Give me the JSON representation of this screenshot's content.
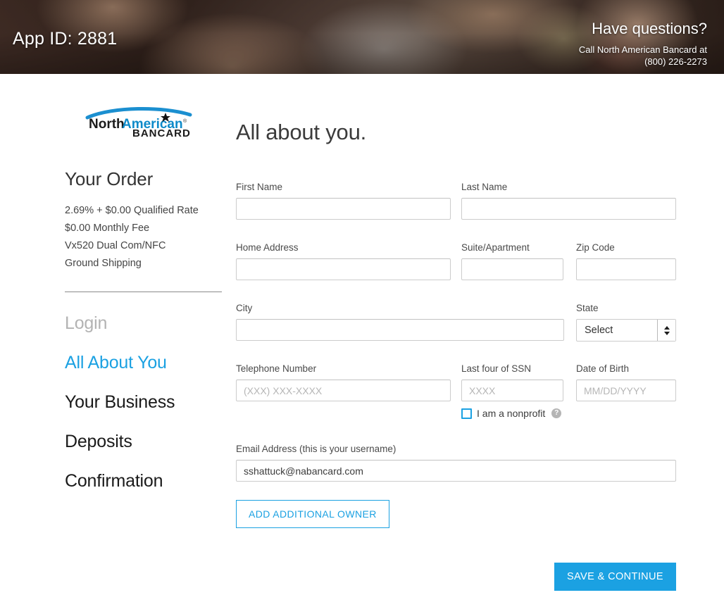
{
  "hero": {
    "app_id_label": "App ID: 2881",
    "questions_heading": "Have questions?",
    "call_line1": "Call North American Bancard at",
    "call_line2": "(800) 226-2273"
  },
  "brand": {
    "logo_north": "North",
    "logo_american": "American",
    "logo_bancard": "BANCARD",
    "logo_registered": "®",
    "accent_color": "#1BA1E2",
    "logo_blue": "#0D8AC9"
  },
  "sidebar": {
    "order_title": "Your Order",
    "order_items": [
      "2.69% + $0.00 Qualified Rate",
      "$0.00 Monthly Fee",
      "Vx520 Dual Com/NFC",
      "Ground Shipping"
    ],
    "nav_items": [
      {
        "label": "Login",
        "state": "done"
      },
      {
        "label": "All About You",
        "state": "active"
      },
      {
        "label": "Your Business",
        "state": "todo"
      },
      {
        "label": "Deposits",
        "state": "todo"
      },
      {
        "label": "Confirmation",
        "state": "todo"
      }
    ]
  },
  "form": {
    "title": "All about you.",
    "first_name": {
      "label": "First Name",
      "value": "",
      "placeholder": ""
    },
    "last_name": {
      "label": "Last Name",
      "value": "",
      "placeholder": ""
    },
    "home_address": {
      "label": "Home Address",
      "value": "",
      "placeholder": ""
    },
    "suite": {
      "label": "Suite/Apartment",
      "value": "",
      "placeholder": ""
    },
    "zip": {
      "label": "Zip Code",
      "value": "",
      "placeholder": ""
    },
    "city": {
      "label": "City",
      "value": "",
      "placeholder": ""
    },
    "state": {
      "label": "State",
      "selected": "Select",
      "options": [
        "Select"
      ]
    },
    "telephone": {
      "label": "Telephone Number",
      "value": "",
      "placeholder": "(XXX) XXX-XXXX"
    },
    "ssn": {
      "label": "Last four of SSN",
      "value": "",
      "placeholder": "XXXX"
    },
    "dob": {
      "label": "Date of Birth",
      "value": "",
      "placeholder": "MM/DD/YYYY"
    },
    "nonprofit": {
      "label": "I am a nonprofit",
      "checked": false,
      "help_glyph": "?"
    },
    "email": {
      "label": "Email Address (this is your username)",
      "value": "sshattuck@nabancard.com",
      "placeholder": ""
    },
    "add_owner_button": "ADD ADDITIONAL OWNER",
    "save_button": "SAVE & CONTINUE"
  }
}
